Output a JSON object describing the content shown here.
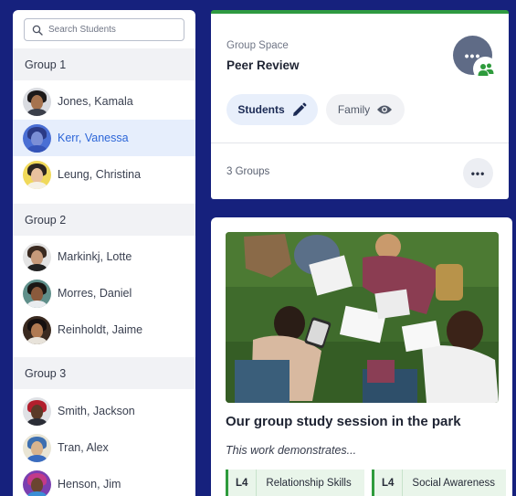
{
  "search": {
    "placeholder": "Search Students"
  },
  "groups": [
    {
      "name": "Group 1",
      "students": [
        {
          "name": "Jones, Kamala",
          "selected": false
        },
        {
          "name": "Kerr, Vanessa",
          "selected": true
        },
        {
          "name": "Leung, Christina",
          "selected": false
        }
      ]
    },
    {
      "name": "Group 2",
      "students": [
        {
          "name": "Markinkj, Lotte",
          "selected": false
        },
        {
          "name": "Morres, Daniel",
          "selected": false
        },
        {
          "name": "Reinholdt, Jaime",
          "selected": false
        }
      ]
    },
    {
      "name": "Group 3",
      "students": [
        {
          "name": "Smith, Jackson",
          "selected": false
        },
        {
          "name": "Tran, Alex",
          "selected": false
        },
        {
          "name": "Henson, Jim",
          "selected": false
        }
      ]
    }
  ],
  "group_space": {
    "label": "Group Space",
    "title": "Peer Review",
    "students_pill": "Students",
    "family_pill": "Family",
    "groups_count": "3 Groups",
    "more_label": "•••",
    "avatar_dots": "•••"
  },
  "post": {
    "title": "Our group study session in the park",
    "subtitle": "This work demonstrates...",
    "tags": [
      {
        "level": "L4",
        "label": "Relationship Skills"
      },
      {
        "level": "L4",
        "label": "Social Awareness"
      }
    ]
  },
  "icons": {
    "search": "search-icon",
    "pencil": "pencil-icon",
    "eye": "eye-icon",
    "group": "group-icon",
    "more": "more-icon"
  },
  "colors": {
    "background": "#16217d",
    "accent_green": "#2f9a41",
    "selected_text": "#2d66d8",
    "selected_bg": "#e6eefc"
  }
}
